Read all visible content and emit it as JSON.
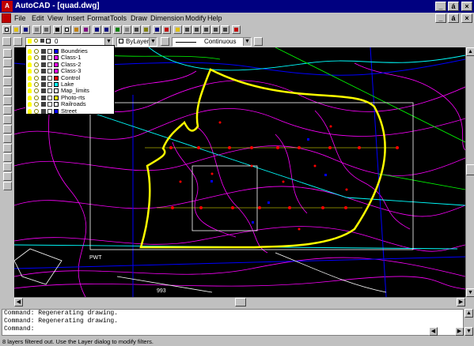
{
  "window": {
    "title": "AutoCAD - [quad.dwg]",
    "app_icon": "A",
    "controls": [
      "_",
      "á",
      "×"
    ]
  },
  "menu": [
    "File",
    "Edit",
    "View",
    "Insert",
    "Format",
    "Tools",
    "Draw",
    "Dimension",
    "Modify",
    "Help"
  ],
  "properties": {
    "layer_value": "0",
    "color_value": "ByLayer",
    "linetype_value": "Continuous"
  },
  "layer_dropdown": {
    "items": [
      {
        "name": "Boundries",
        "color": "#0000ff"
      },
      {
        "name": "Class-1",
        "color": "#ff00ff"
      },
      {
        "name": "Class-2",
        "color": "#ff00ff"
      },
      {
        "name": "Class-3",
        "color": "#ff00ff"
      },
      {
        "name": "Control",
        "color": "#ff0000"
      },
      {
        "name": "Lake",
        "color": "#00ffff"
      },
      {
        "name": "Map_limits",
        "color": "#ffffff"
      },
      {
        "name": "Photo-rts",
        "color": "#ffff00"
      },
      {
        "name": "Railroads",
        "color": "#ffffff"
      },
      {
        "name": "Street",
        "color": "#0000ff"
      }
    ]
  },
  "canvas": {
    "labels": [
      "PWT",
      "993"
    ]
  },
  "command": {
    "lines": [
      "Command: Regenerating drawing.",
      "Command: Regenerating drawing.",
      "Command:"
    ]
  },
  "status": {
    "text": "8 layers filtered out. Use the Layer dialog to modify filters."
  },
  "colors": {
    "titlebar": "#000080",
    "boundary": "#ffff00",
    "contours": "#ff00ff",
    "streets": "#0000ff",
    "lake": "#00ffff",
    "control_points": "#ff0000"
  }
}
